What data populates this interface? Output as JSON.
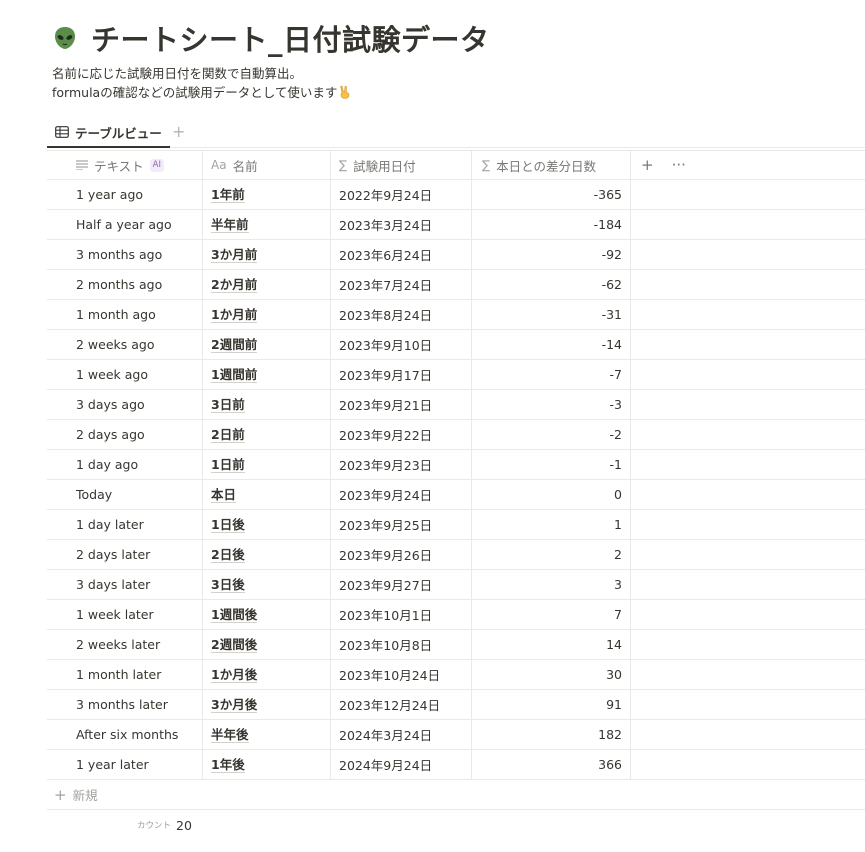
{
  "page": {
    "icon": "alien-icon",
    "title": "チートシート_日付試験データ",
    "description_line1": "名前に応じた試験用日付を関数で自動算出。",
    "description_line2": "formulaの確認などの試験用データとして使います",
    "description_emoji": "victory-hand-icon"
  },
  "view": {
    "tab_label": "テーブルビュー",
    "tab_icon": "table-icon",
    "add_view_icon": "plus-icon"
  },
  "table": {
    "columns": [
      {
        "label": "テキスト",
        "icon": "text-lines-icon",
        "badge": "AI"
      },
      {
        "label": "名前",
        "icon": "title-aa-icon",
        "icon_text": "Aa"
      },
      {
        "label": "試験用日付",
        "icon": "sigma-icon",
        "icon_text": "∑"
      },
      {
        "label": "本日との差分日数",
        "icon": "sigma-icon",
        "icon_text": "∑"
      }
    ],
    "header_actions": {
      "add": "plus-icon",
      "more": "more-icon"
    },
    "rows": [
      [
        "1 year ago",
        "1年前",
        "2022年9月24日",
        "-365"
      ],
      [
        "Half a year ago",
        "半年前",
        "2023年3月24日",
        "-184"
      ],
      [
        "3 months ago",
        "3か月前",
        "2023年6月24日",
        "-92"
      ],
      [
        "2 months ago",
        "2か月前",
        "2023年7月24日",
        "-62"
      ],
      [
        "1 month ago",
        "1か月前",
        "2023年8月24日",
        "-31"
      ],
      [
        "2 weeks ago",
        "2週間前",
        "2023年9月10日",
        "-14"
      ],
      [
        "1 week ago",
        "1週間前",
        "2023年9月17日",
        "-7"
      ],
      [
        "3 days ago",
        "3日前",
        "2023年9月21日",
        "-3"
      ],
      [
        "2 days ago",
        "2日前",
        "2023年9月22日",
        "-2"
      ],
      [
        "1 day ago",
        "1日前",
        "2023年9月23日",
        "-1"
      ],
      [
        "Today",
        "本日",
        "2023年9月24日",
        "0"
      ],
      [
        "1 day later",
        "1日後",
        "2023年9月25日",
        "1"
      ],
      [
        "2 days later",
        "2日後",
        "2023年9月26日",
        "2"
      ],
      [
        "3 days later",
        "3日後",
        "2023年9月27日",
        "3"
      ],
      [
        "1 week later",
        "1週間後",
        "2023年10月1日",
        "7"
      ],
      [
        "2 weeks later",
        "2週間後",
        "2023年10月8日",
        "14"
      ],
      [
        "1 month later",
        "1か月後",
        "2023年10月24日",
        "30"
      ],
      [
        "3 months later",
        "3か月後",
        "2023年12月24日",
        "91"
      ],
      [
        "After six months",
        "半年後",
        "2024年3月24日",
        "182"
      ],
      [
        "1 year later",
        "1年後",
        "2024年9月24日",
        "366"
      ]
    ],
    "new_row_label": "新規",
    "footer": {
      "count_label": "カウント",
      "count_value": "20"
    }
  },
  "colors": {
    "text": "#37352f",
    "muted": "#787774",
    "border": "#e9e9e7",
    "alien_green": "#5a8c4a",
    "ai_badge": "#9065b0"
  }
}
